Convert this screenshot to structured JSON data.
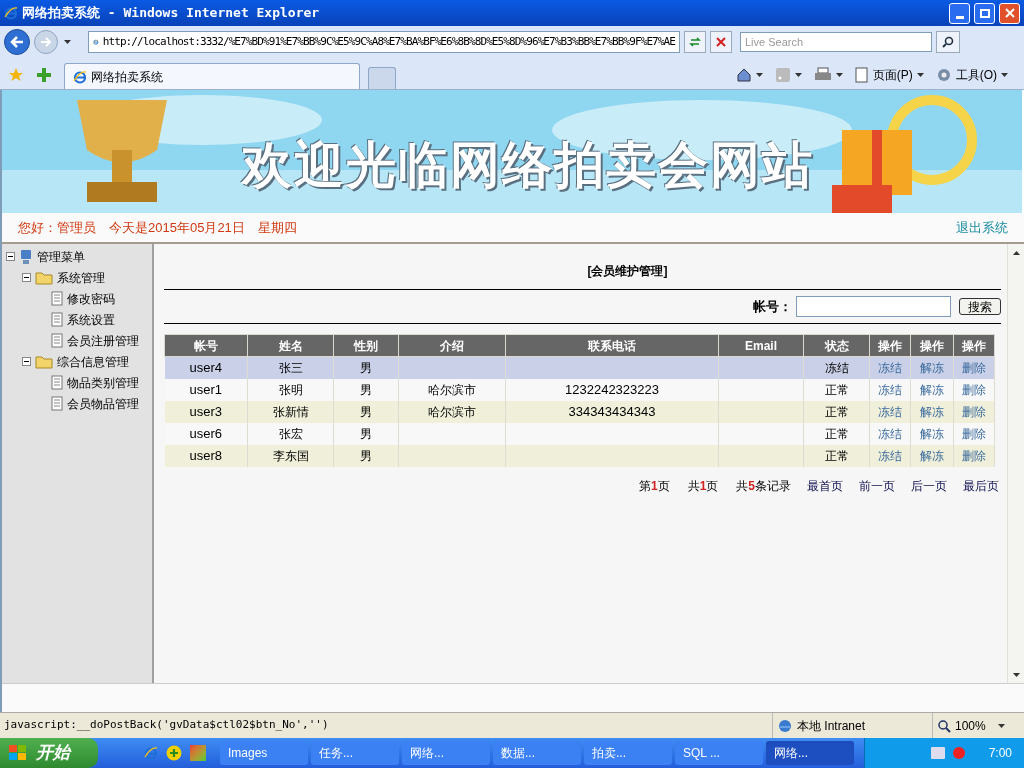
{
  "window": {
    "title": "网络拍卖系统 - Windows Internet Explorer"
  },
  "address_bar": {
    "url": "http://localhost:3332/%E7%BD%91%E7%BB%9C%E5%9C%A8%E7%BA%BF%E6%8B%8D%E5%8D%96%E7%B3%BB%E7%BB%9F%E7%AE"
  },
  "search": {
    "placeholder": "Live Search"
  },
  "tabs": [
    {
      "label": "网络拍卖系统",
      "selected": true
    }
  ],
  "command_bar": [
    {
      "kind": "home"
    },
    {
      "kind": "feed"
    },
    {
      "kind": "print"
    },
    {
      "kind": "page",
      "label": "页面(P)"
    },
    {
      "kind": "tools",
      "label": "工具(O)"
    }
  ],
  "banner": {
    "title": "欢迎光临网络拍卖会网站"
  },
  "greeting": {
    "text": "您好：管理员　今天是2015年05月21日　星期四",
    "logout": "退出系统"
  },
  "sidebar": {
    "tree": [
      {
        "label": "管理菜单",
        "kind": "root",
        "expanded": true,
        "children": [
          {
            "label": "系统管理",
            "kind": "folder",
            "expanded": true,
            "children": [
              {
                "label": "修改密码",
                "kind": "page"
              },
              {
                "label": "系统设置",
                "kind": "page"
              },
              {
                "label": "会员注册管理",
                "kind": "page"
              }
            ]
          },
          {
            "label": "综合信息管理",
            "kind": "folder",
            "expanded": true,
            "children": [
              {
                "label": "物品类别管理",
                "kind": "page"
              },
              {
                "label": "会员物品管理",
                "kind": "page"
              }
            ]
          }
        ]
      }
    ]
  },
  "main": {
    "title": "[会员维护管理]",
    "search_label": "帐号：",
    "search_button": "搜索"
  },
  "table": {
    "columns": [
      "帐号",
      "姓名",
      "性别",
      "介绍",
      "联系电话",
      "Email",
      "状态",
      "操作",
      "操作",
      "操作"
    ],
    "rows": [
      {
        "selected": true,
        "cells": [
          "user4",
          "张三",
          "男",
          "",
          "",
          "",
          "冻结"
        ],
        "actions": [
          "冻结",
          "解冻",
          "删除"
        ]
      },
      {
        "selected": false,
        "cells": [
          "user1",
          "张明",
          "男",
          "哈尔滨市",
          "1232242323223",
          "",
          "正常"
        ],
        "actions": [
          "冻结",
          "解冻",
          "删除"
        ]
      },
      {
        "selected": false,
        "cells": [
          "user3",
          "张新情",
          "男",
          "哈尔滨市",
          "334343434343",
          "",
          "正常"
        ],
        "actions": [
          "冻结",
          "解冻",
          "删除"
        ]
      },
      {
        "selected": false,
        "cells": [
          "user6",
          "张宏",
          "男",
          "",
          "",
          "",
          "正常"
        ],
        "actions": [
          "冻结",
          "解冻",
          "删除"
        ]
      },
      {
        "selected": false,
        "cells": [
          "user8",
          "李东国",
          "男",
          "",
          "",
          "",
          "正常"
        ],
        "actions": [
          "冻结",
          "解冻",
          "删除"
        ]
      }
    ]
  },
  "pager": {
    "counts": [
      {
        "before": "第",
        "number": "1",
        "after": "页"
      },
      {
        "before": "共",
        "number": "1",
        "after": "页"
      },
      {
        "before": "共",
        "number": "5",
        "after": "条记录"
      }
    ],
    "links": [
      "最首页",
      "前一页",
      "后一页",
      "最后页"
    ]
  },
  "status_bar": {
    "text": "javascript:__doPostBack('gvData$ctl02$btn_No','')",
    "zone": "本地 Intranet",
    "zoom": "100%"
  },
  "taskbar": {
    "start": "开始",
    "tasks": [
      {
        "label": "Images",
        "selected": false
      },
      {
        "label": "任务...",
        "selected": false
      },
      {
        "label": "网络...",
        "selected": false
      },
      {
        "label": "数据...",
        "selected": false
      },
      {
        "label": "拍卖...",
        "selected": false
      },
      {
        "label": "SQL ...",
        "selected": false
      },
      {
        "label": "网络...",
        "selected": true
      }
    ],
    "time": "7:00"
  }
}
